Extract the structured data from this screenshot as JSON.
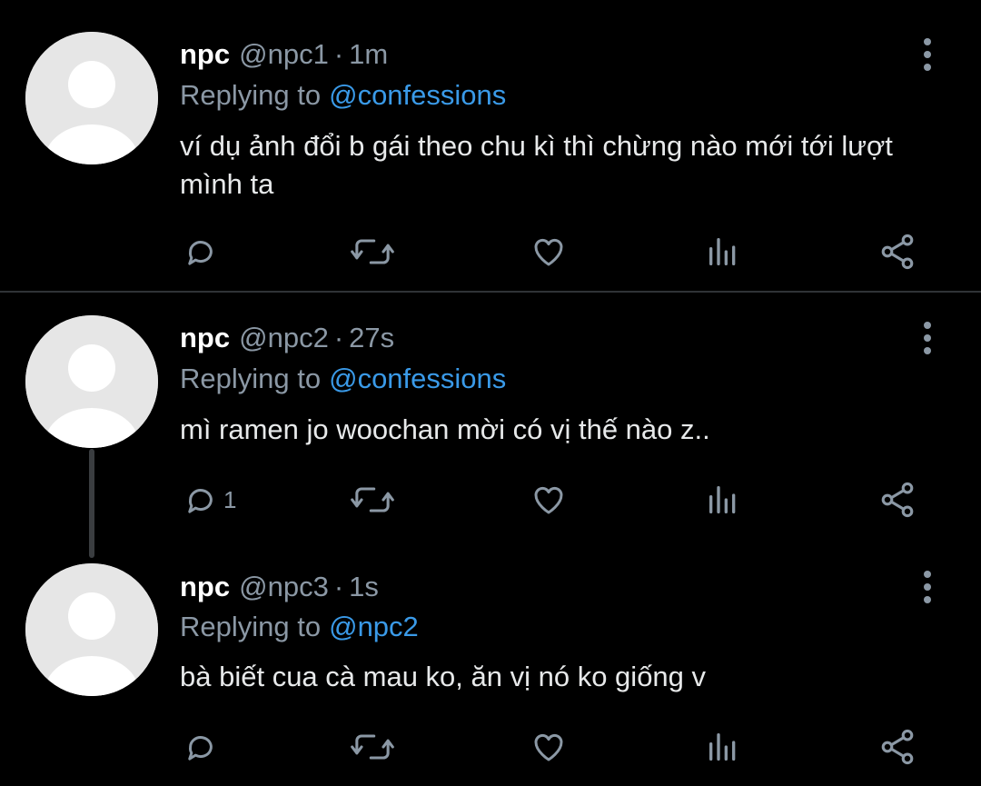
{
  "tweets": [
    {
      "name": "npc",
      "handle": "@npc1",
      "separator": "·",
      "time": "1m",
      "replying_prefix": "Replying to",
      "replying_to": "@confessions",
      "text": "ví dụ ảnh đổi b gái theo chu kì thì chừng nào mới tới lượt mình ta",
      "reply_count": ""
    },
    {
      "name": "npc",
      "handle": "@npc2",
      "separator": "·",
      "time": "27s",
      "replying_prefix": "Replying to",
      "replying_to": "@confessions",
      "text": "mì ramen jo woochan mời có vị thế nào z..",
      "reply_count": "1"
    },
    {
      "name": "npc",
      "handle": "@npc3",
      "separator": "·",
      "time": "1s",
      "replying_prefix": "Replying to",
      "replying_to": "@npc2",
      "text": "bà biết cua cà mau ko, ăn vị nó ko giống v",
      "reply_count": ""
    }
  ],
  "icons": {
    "reply": "reply-icon",
    "retweet": "retweet-icon",
    "like": "like-icon",
    "views": "views-icon",
    "share": "share-icon",
    "more": "more-vertical-icon"
  },
  "colors": {
    "background": "#000000",
    "mention": "#3a9ae8",
    "secondary_text": "#8b98a5",
    "primary_text": "#e7e9ea",
    "avatar_bg": "#e6e6e6"
  }
}
